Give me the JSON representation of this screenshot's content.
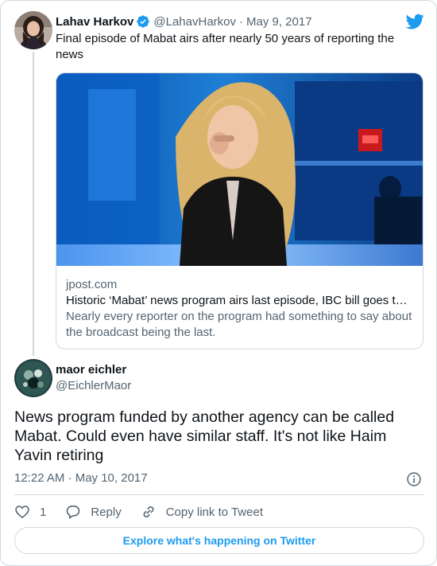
{
  "parent": {
    "name": "Lahav Harkov",
    "handle": "@LahavHarkov",
    "separator": "·",
    "date": "May 9, 2017",
    "text": "Final episode of Mabat airs after nearly 50 years of reporting the news",
    "link_card": {
      "domain": "jpost.com",
      "title": "Historic ‘Mabat’ news program airs last episode, IBC bill goes t…",
      "description": "Nearly every reporter on the program had something to say about the broadcast being the last."
    }
  },
  "reply": {
    "name": "maor eichler",
    "handle": "@EichlerMaor",
    "text": "News program funded by another agency can be called Mabat. Could even have similar staff. It's not like Haim Yavin retiring",
    "timestamp": "12:22 AM · May 10, 2017"
  },
  "actions": {
    "like_count": "1",
    "reply_label": "Reply",
    "copy_label": "Copy link to Tweet"
  },
  "footer": {
    "explore_label": "Explore what's happening on Twitter"
  },
  "colors": {
    "accent": "#1d9bf0",
    "text": "#0f1419",
    "muted": "#536471",
    "border": "#cfd9de"
  },
  "icons": [
    "verified-badge-icon",
    "twitter-bird-icon",
    "info-icon",
    "heart-icon",
    "reply-bubble-icon",
    "link-icon"
  ]
}
